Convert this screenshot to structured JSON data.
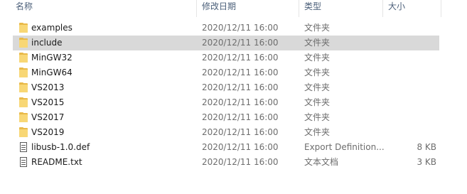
{
  "columns": {
    "name": "名称",
    "date": "修改日期",
    "type": "类型",
    "size": "大小"
  },
  "rows": [
    {
      "name": "examples",
      "date": "2020/12/11 16:00",
      "type": "文件夹",
      "size": "",
      "icon": "folder-icon",
      "selected": false
    },
    {
      "name": "include",
      "date": "2020/12/11 16:00",
      "type": "文件夹",
      "size": "",
      "icon": "folder-icon",
      "selected": true
    },
    {
      "name": "MinGW32",
      "date": "2020/12/11 16:00",
      "type": "文件夹",
      "size": "",
      "icon": "folder-icon",
      "selected": false
    },
    {
      "name": "MinGW64",
      "date": "2020/12/11 16:00",
      "type": "文件夹",
      "size": "",
      "icon": "folder-icon",
      "selected": false
    },
    {
      "name": "VS2013",
      "date": "2020/12/11 16:00",
      "type": "文件夹",
      "size": "",
      "icon": "folder-icon",
      "selected": false
    },
    {
      "name": "VS2015",
      "date": "2020/12/11 16:00",
      "type": "文件夹",
      "size": "",
      "icon": "folder-icon",
      "selected": false
    },
    {
      "name": "VS2017",
      "date": "2020/12/11 16:00",
      "type": "文件夹",
      "size": "",
      "icon": "folder-icon",
      "selected": false
    },
    {
      "name": "VS2019",
      "date": "2020/12/11 16:00",
      "type": "文件夹",
      "size": "",
      "icon": "folder-icon",
      "selected": false
    },
    {
      "name": "libusb-1.0.def",
      "date": "2020/12/11 16:00",
      "type": "Export Definition...",
      "size": "8 KB",
      "icon": "file-icon",
      "selected": false
    },
    {
      "name": "README.txt",
      "date": "2020/12/11 16:00",
      "type": "文本文档",
      "size": "3 KB",
      "icon": "file-icon",
      "selected": false
    }
  ]
}
